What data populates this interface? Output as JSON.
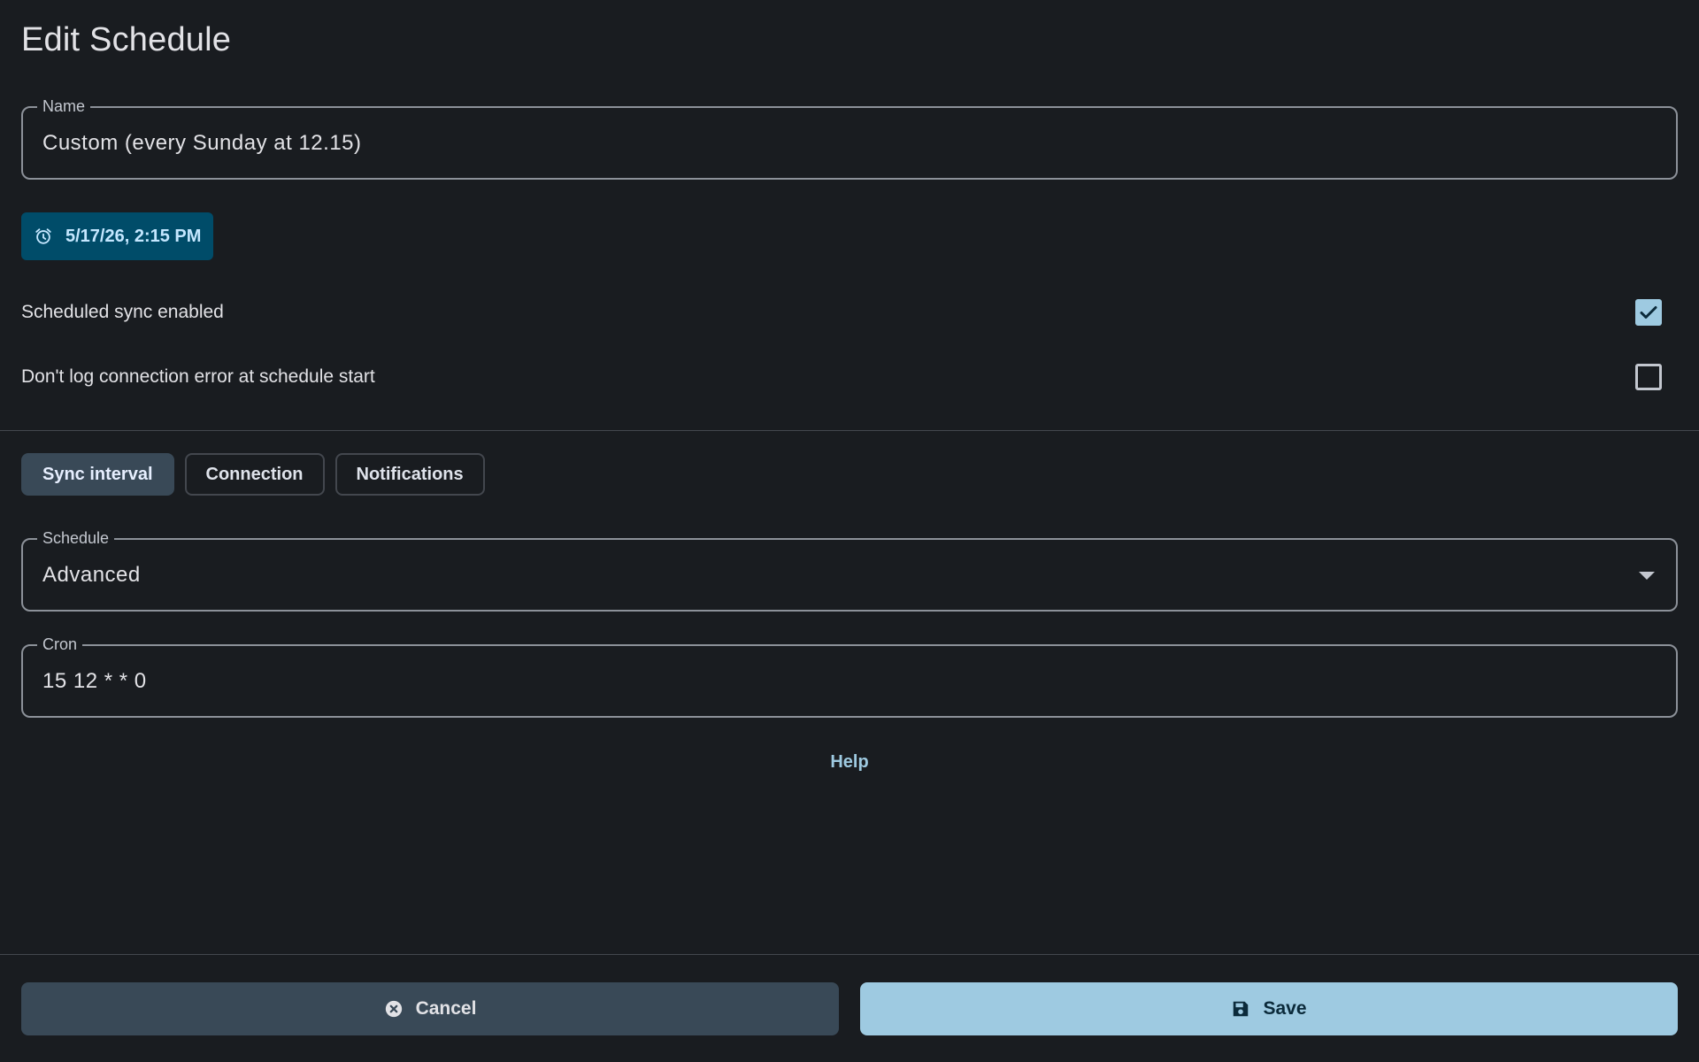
{
  "title": "Edit Schedule",
  "name_field": {
    "label": "Name",
    "value": "Custom (every Sunday at 12.15)"
  },
  "next_run": {
    "label": "5/17/26, 2:15 PM",
    "icon": "alarm-icon"
  },
  "options": [
    {
      "label": "Scheduled sync enabled",
      "checked": true
    },
    {
      "label": "Don't log connection error at schedule start",
      "checked": false
    }
  ],
  "tabs": [
    {
      "label": "Sync interval",
      "active": true
    },
    {
      "label": "Connection",
      "active": false
    },
    {
      "label": "Notifications",
      "active": false
    }
  ],
  "schedule_field": {
    "label": "Schedule",
    "value": "Advanced"
  },
  "cron_field": {
    "label": "Cron",
    "value": "15 12 * * 0"
  },
  "help_label": "Help",
  "actions": {
    "cancel_label": "Cancel",
    "save_label": "Save"
  },
  "colors": {
    "background": "#191c20",
    "accent": "#9ecae1",
    "chip_bg": "#004c69",
    "tonal_button": "#394957"
  }
}
